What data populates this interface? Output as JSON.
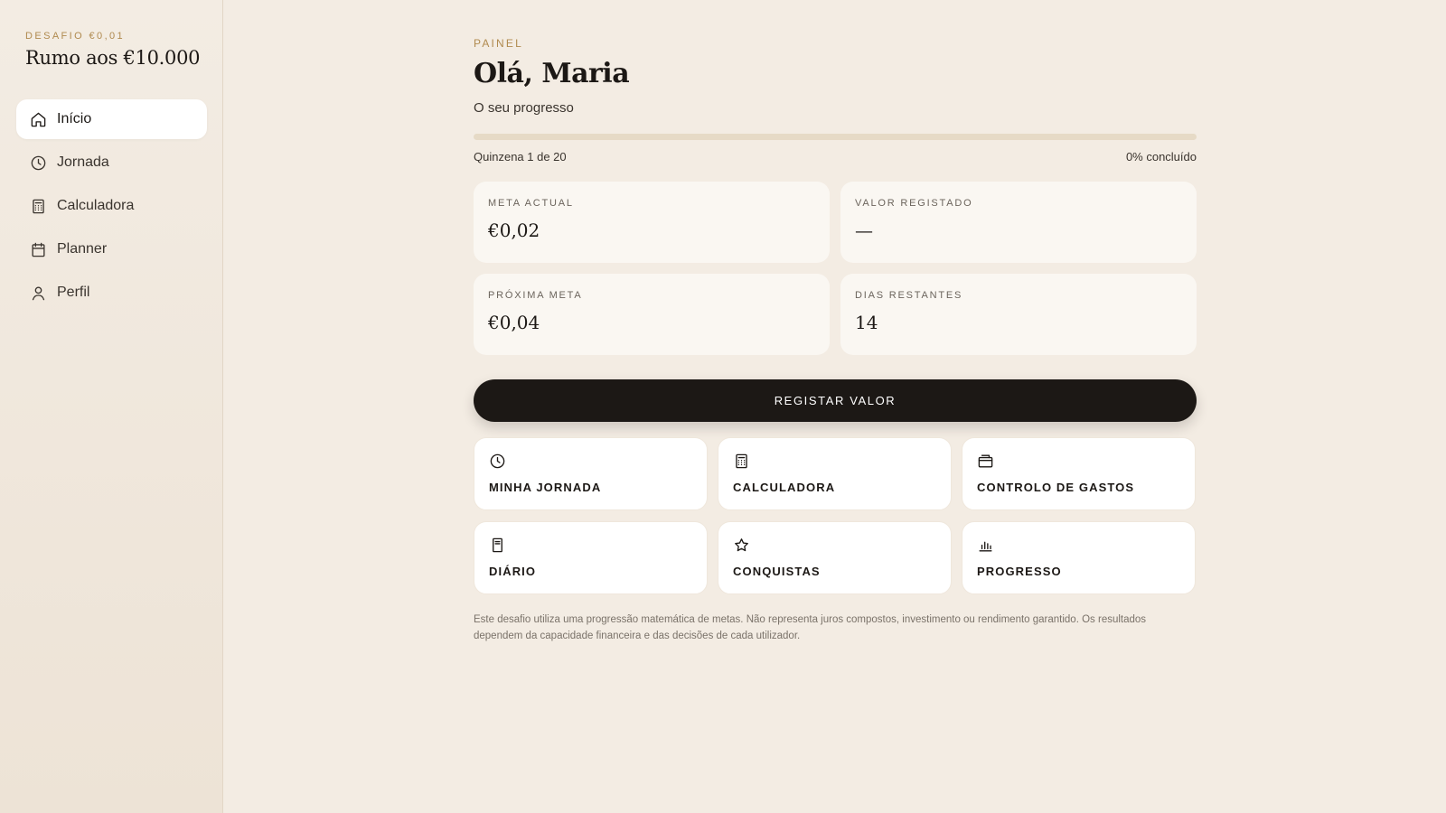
{
  "sidebar": {
    "kicker": "DESAFIO €0,01",
    "title": "Rumo aos €10.000",
    "items": [
      {
        "label": "Início",
        "icon": "home-icon",
        "active": true
      },
      {
        "label": "Jornada",
        "icon": "clock-icon",
        "active": false
      },
      {
        "label": "Calculadora",
        "icon": "calculator-icon",
        "active": false
      },
      {
        "label": "Planner",
        "icon": "calendar-icon",
        "active": false
      },
      {
        "label": "Perfil",
        "icon": "user-icon",
        "active": false
      }
    ]
  },
  "main": {
    "kicker": "PAINEL",
    "greeting": "Olá, Maria",
    "subtitle": "O seu progresso",
    "progress": {
      "fraction": 0,
      "left_label": "Quinzena 1 de 20",
      "right_label": "0% concluído"
    },
    "stats": [
      {
        "label": "META ACTUAL",
        "value": "€0,02"
      },
      {
        "label": "VALOR REGISTADO",
        "value": "—"
      },
      {
        "label": "PRÓXIMA META",
        "value": "€0,04"
      },
      {
        "label": "DIAS RESTANTES",
        "value": "14"
      }
    ],
    "cta_label": "REGISTAR VALOR",
    "tiles": [
      {
        "label": "MINHA JORNADA",
        "icon": "clock-icon"
      },
      {
        "label": "CALCULADORA",
        "icon": "calculator-icon"
      },
      {
        "label": "CONTROLO DE GASTOS",
        "icon": "wallet-icon"
      },
      {
        "label": "DIÁRIO",
        "icon": "journal-icon"
      },
      {
        "label": "CONQUISTAS",
        "icon": "star-icon"
      },
      {
        "label": "PROGRESSO",
        "icon": "bar-chart-icon"
      }
    ],
    "disclaimer": "Este desafio utiliza uma progressão matemática de metas. Não representa juros compostos, investimento ou rendimento garantido. Os resultados dependem da capacidade financeira e das decisões de cada utilizador."
  },
  "colors": {
    "background": "#f3ece3",
    "accent": "#b08a4e",
    "dark": "#1c1815",
    "card": "#faf7f2"
  }
}
